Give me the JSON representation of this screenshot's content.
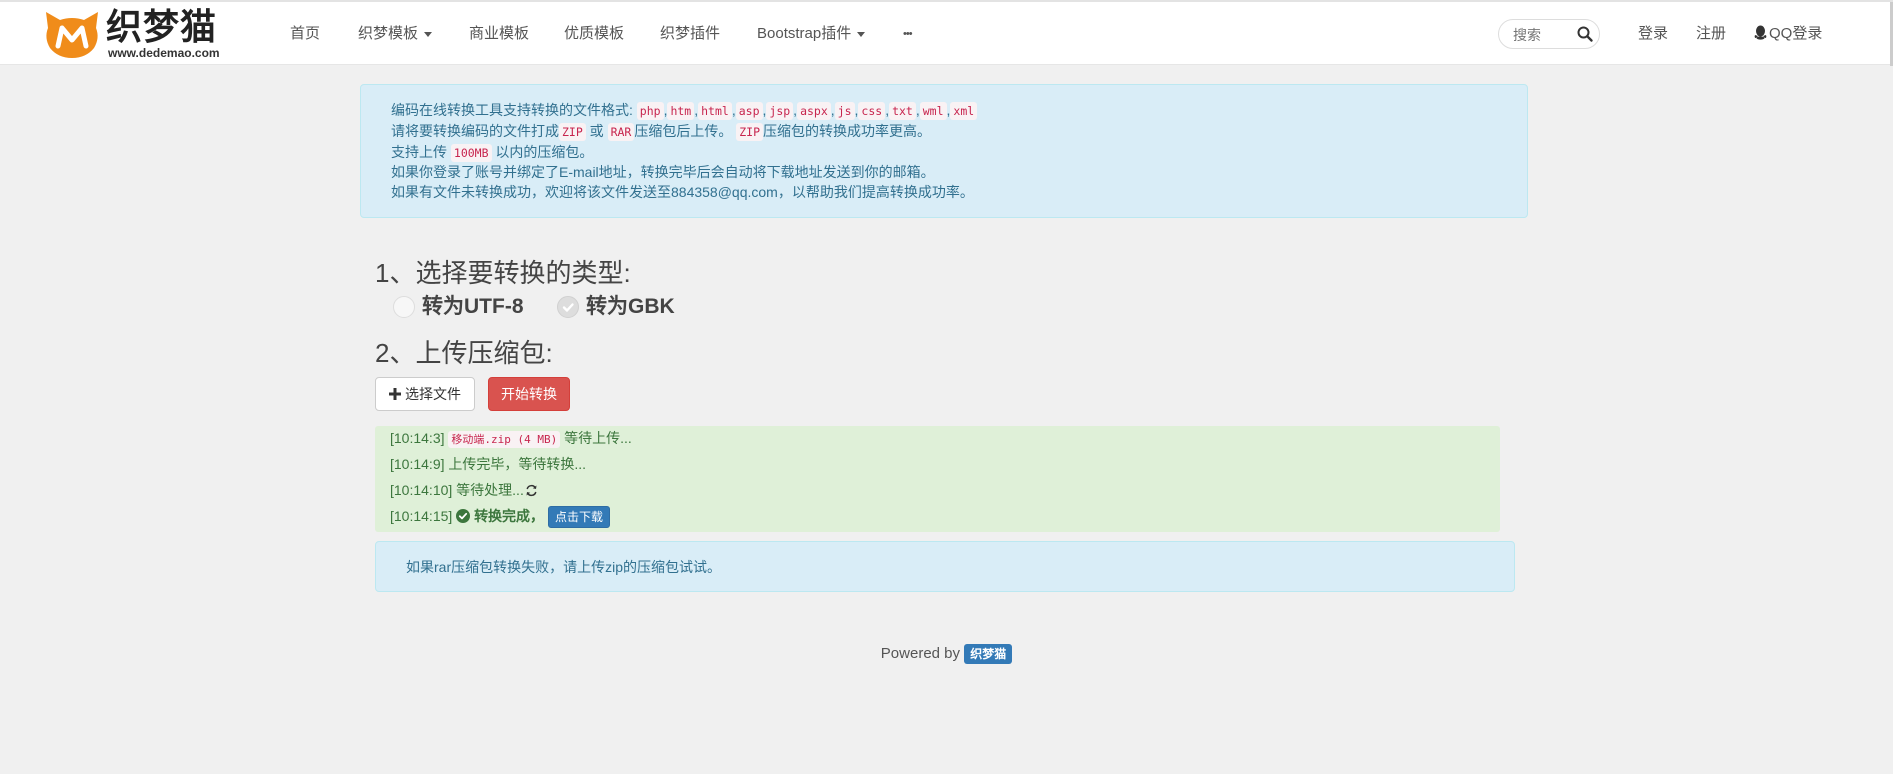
{
  "brand": {
    "title": "织梦猫",
    "url": "www.dedemao.com"
  },
  "nav": {
    "items": [
      {
        "label": "首页",
        "dropdown": false
      },
      {
        "label": "织梦模板",
        "dropdown": true
      },
      {
        "label": "商业模板",
        "dropdown": false
      },
      {
        "label": "优质模板",
        "dropdown": false
      },
      {
        "label": "织梦插件",
        "dropdown": false
      },
      {
        "label": "Bootstrap插件",
        "dropdown": true
      },
      {
        "label": "•••",
        "dropdown": false
      }
    ],
    "search_placeholder": "搜索",
    "login": "登录",
    "register": "注册",
    "qq_login": "QQ登录"
  },
  "info": {
    "line1_prefix": "编码在线转换工具支持转换的文件格式:",
    "formats": [
      "php",
      "htm",
      "html",
      "asp",
      "jsp",
      "aspx",
      "js",
      "css",
      "txt",
      "wml",
      "xml"
    ],
    "format_sep": ",",
    "line2_a": "请将要转换编码的文件打成",
    "line2_zip": "ZIP",
    "line2_or": "或",
    "line2_rar": "RAR",
    "line2_b": "压缩包后上传。",
    "line2_zip2": "ZIP",
    "line2_c": "压缩包的转换成功率更高。",
    "line3_a": "支持上传",
    "line3_size": "100MB",
    "line3_b": "以内的压缩包。",
    "line4": "如果你登录了账号并绑定了E-mail地址，转换完毕后会自动将下载地址发送到你的邮箱。",
    "line5": "如果有文件未转换成功，欢迎将该文件发送至884358@qq.com，以帮助我们提高转换成功率。"
  },
  "step1": {
    "title": "1、选择要转换的类型:",
    "options": [
      {
        "label": "转为UTF-8",
        "checked": false
      },
      {
        "label": "转为GBK",
        "checked": true
      }
    ]
  },
  "step2": {
    "title": "2、上传压缩包:",
    "choose_file": "选择文件",
    "start": "开始转换"
  },
  "log": {
    "line1_time": "[10:14:3]",
    "line1_file": "移动端.zip (4 MB)",
    "line1_text": "等待上传...",
    "line2_time": "[10:14:9]",
    "line2_text": "上传完毕，等待转换...",
    "line3_time": "[10:14:10]",
    "line3_text": "等待处理...",
    "line4_time": "[10:14:15]",
    "line4_text": "转换完成，",
    "download": "点击下载"
  },
  "note": "如果rar压缩包转换失败，请上传zip的压缩包试试。",
  "footer": {
    "powered": "Powered by",
    "badge": "织梦猫"
  },
  "colors": {
    "info_bg": "#d9edf7",
    "info_text": "#31708f",
    "success_bg": "#dff0d8",
    "success_text": "#3c763d",
    "danger": "#d9534f",
    "primary": "#337ab7",
    "logo_orange": "#f08c1a"
  },
  "icons": {
    "search": "search-icon",
    "qq": "qq-icon",
    "plus": "plus-icon",
    "spinner": "refresh-icon",
    "check": "check-circle-icon"
  }
}
